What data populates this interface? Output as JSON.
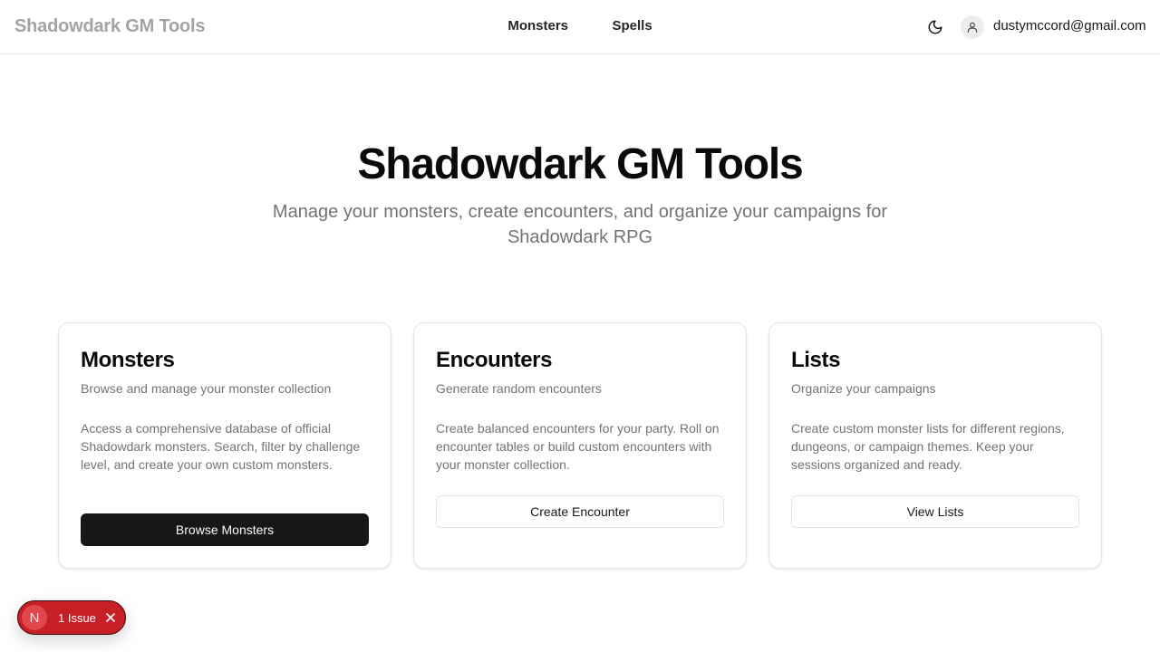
{
  "header": {
    "brand": "Shadowdark GM Tools",
    "nav": [
      {
        "label": "Monsters"
      },
      {
        "label": "Spells"
      }
    ],
    "user_email": "dustymccord@gmail.com",
    "icons": {
      "theme": "moon-icon",
      "avatar": "user-icon"
    }
  },
  "hero": {
    "title": "Shadowdark GM Tools",
    "subtitle": "Manage your monsters, create encounters, and organize your campaigns for Shadowdark RPG"
  },
  "cards": [
    {
      "title": "Monsters",
      "subtitle": "Browse and manage your monster collection",
      "body": "Access a comprehensive database of official Shadowdark monsters. Search, filter by challenge level, and create your own custom monsters.",
      "button": "Browse Monsters"
    },
    {
      "title": "Encounters",
      "subtitle": "Generate random encounters",
      "body": "Create balanced encounters for your party. Roll on encounter tables or build custom encounters with your monster collection.",
      "button": "Create Encounter"
    },
    {
      "title": "Lists",
      "subtitle": "Organize your campaigns",
      "body": "Create custom monster lists for different regions, dungeons, or campaign themes. Keep your sessions organized and ready.",
      "button": "View Lists"
    }
  ],
  "dev_badge": {
    "logo_letter": "N",
    "issues_label": "1 Issue",
    "color": "#c81e25"
  }
}
